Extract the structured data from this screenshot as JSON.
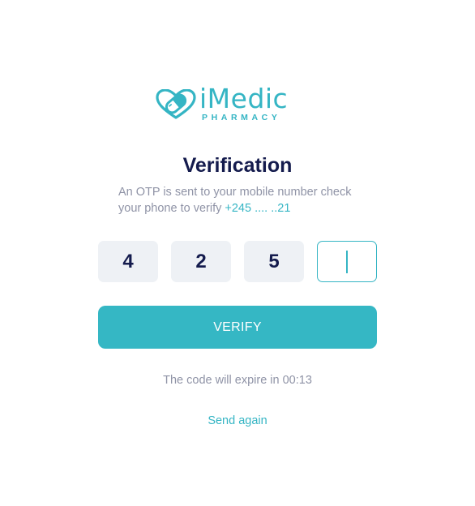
{
  "brand": {
    "name": "iMedic",
    "tagline": "PHARMACY",
    "accent_color": "#35b5c4"
  },
  "page": {
    "title": "Verification",
    "description_text": "An OTP is sent to your mobile number check your phone to verify",
    "phone_masked": "+245 .... ..21"
  },
  "otp": {
    "digits": [
      "4",
      "2",
      "5",
      ""
    ],
    "active_index": 3
  },
  "actions": {
    "verify_label": "VERIFY",
    "expire_text": "The code will expire in 00:13",
    "send_again_label": "Send again"
  }
}
